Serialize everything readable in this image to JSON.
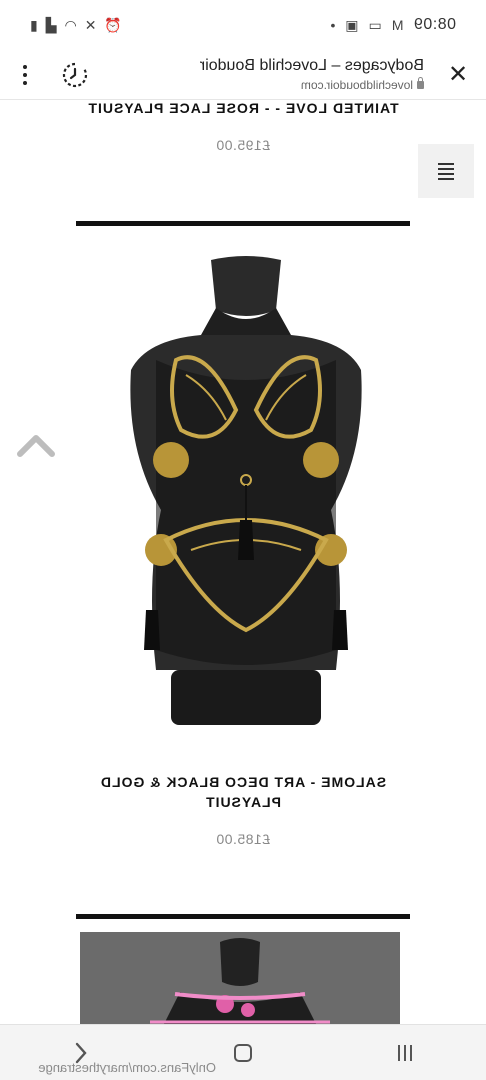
{
  "status_bar": {
    "time": "08:09",
    "left_icons": [
      "gmail-icon",
      "cast-icon",
      "image-icon",
      "dot-icon"
    ],
    "right_icons": [
      "alarm-icon",
      "mute-icon",
      "wifi-icon",
      "signal-icon",
      "battery-icon"
    ]
  },
  "browser": {
    "title": "Bodycages – Lovechild Boudoir",
    "domain": "lovechildboudoir.com",
    "close_icon": "close-icon",
    "history_icon": "history-icon",
    "menu_icon": "more-vert-icon"
  },
  "products": [
    {
      "title": "TAINTED LOVE - - ROSE LACE PLAYSUIT",
      "price": "£195.00"
    },
    {
      "title": "SALOME - ART DECO BLACK & GOLD PLAYSUIT",
      "price": "£185.00"
    }
  ],
  "site_menu_icon": "hamburger-icon",
  "scroll_top_icon": "chevron-up-icon",
  "watermark": "OnlyFans.com/marythestrange",
  "nav_bar": {
    "back_icon": "chevron-left-icon",
    "home_icon": "home-icon",
    "recents_icon": "recents-icon"
  },
  "colors": {
    "divider": "#111111",
    "price": "#888888",
    "gold": "#c9a94c"
  }
}
